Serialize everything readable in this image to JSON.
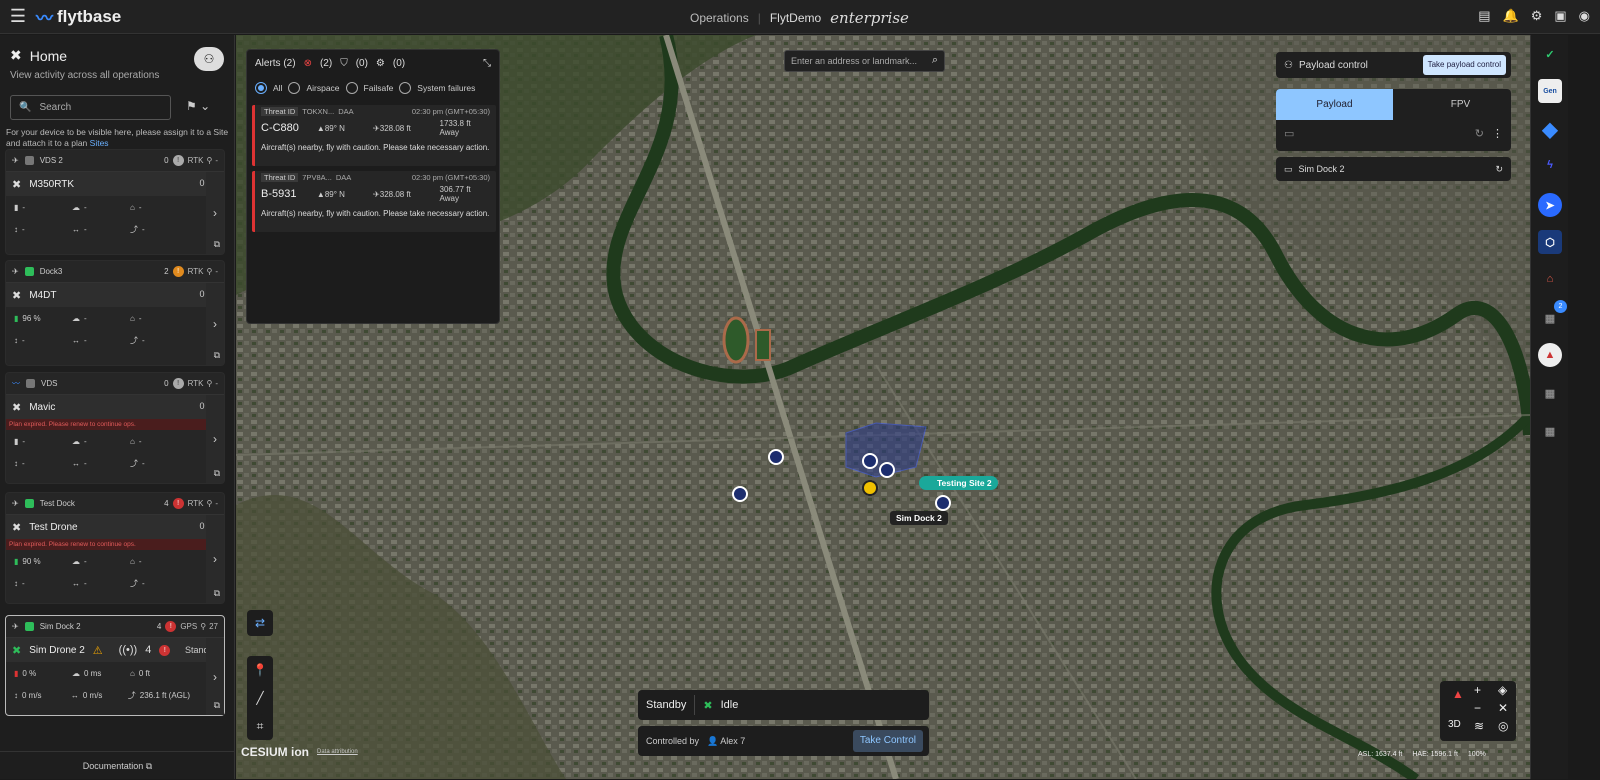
{
  "topbar": {
    "brand": "flytbase",
    "operations": "Operations",
    "org": "FlytDemo",
    "edition": "enterprise"
  },
  "sidebar": {
    "title": "Home",
    "subtitle": "View activity across all operations",
    "search_placeholder": "Search",
    "note": "For your device to be visible here, please assign it to a Site and attach it to a plan",
    "note_link": "Sites",
    "documentation": "Documentation",
    "cards": [
      {
        "dock": "VDS 2",
        "dock_count": "0",
        "rtk": "RTK",
        "drone": "M350RTK",
        "drone_count": "0",
        "battery": "-",
        "wind": "-",
        "home": "-",
        "alt": "-",
        "speed": "-",
        "hspeed": "-",
        "expired": ""
      },
      {
        "dock": "Dock3",
        "dock_count": "2",
        "rtk": "RTK",
        "drone": "M4DT",
        "drone_count": "0",
        "battery": "96 %",
        "wind": "-",
        "home": "-",
        "alt": "-",
        "speed": "-",
        "hspeed": "-",
        "expired": ""
      },
      {
        "dock": "VDS",
        "dock_count": "0",
        "rtk": "RTK",
        "drone": "Mavic",
        "drone_count": "0",
        "battery": "-",
        "wind": "-",
        "home": "-",
        "alt": "-",
        "speed": "-",
        "hspeed": "-",
        "expired": "Plan expired. Please renew to continue ops."
      },
      {
        "dock": "Test Dock",
        "dock_count": "4",
        "rtk": "RTK",
        "drone": "Test Drone",
        "drone_count": "0",
        "battery": "90 %",
        "wind": "-",
        "home": "-",
        "alt": "-",
        "speed": "-",
        "hspeed": "-",
        "expired": "Plan expired. Please renew to continue ops."
      },
      {
        "dock": "Sim Dock 2",
        "dock_count": "4",
        "rtk": "GPS",
        "sats": "27",
        "drone": "Sim Drone 2",
        "drone_count": "4",
        "state": "Standby",
        "battery": "0 %",
        "wind": "0 ms",
        "home": "0 ft",
        "alt": "236.1 ft (AGL)",
        "speed": "0 m/s",
        "hspeed": "0 m/s",
        "expired": ""
      }
    ]
  },
  "alerts": {
    "title": "Alerts (2)",
    "c1": "(2)",
    "c2": "(0)",
    "c3": "(0)",
    "filters": [
      "All",
      "Airspace",
      "Failsafe",
      "System failures"
    ],
    "items": [
      {
        "tid_label": "Threat ID",
        "tid": "TOKXN...",
        "type": "DAA",
        "time": "02:30 pm (GMT+05:30)",
        "callsign": "C-C880",
        "heading": "89° N",
        "alt": "328.08 ft",
        "dist": "1733.8 ft Away",
        "msg": "Aircraft(s) nearby, fly with caution. Please take necessary action."
      },
      {
        "tid_label": "Threat ID",
        "tid": "7PV8A...",
        "type": "DAA",
        "time": "02:30 pm (GMT+05:30)",
        "callsign": "B-5931",
        "heading": "89° N",
        "alt": "328.08 ft",
        "dist": "306.77 ft Away",
        "msg": "Aircraft(s) nearby, fly with caution. Please take necessary action."
      }
    ]
  },
  "map": {
    "address_placeholder": "Enter an address or landmark...",
    "site_label": "Testing Site 2",
    "dock_label": "Sim Dock 2",
    "attribution": "Data attribution",
    "cesium": "CESIUM ion"
  },
  "payload": {
    "title": "Payload control",
    "take": "Take payload control",
    "tab1": "Payload",
    "tab2": "FPV",
    "sim_dock": "Sim Dock 2"
  },
  "status": {
    "mode": "Standby",
    "state": "Idle",
    "controlled_by": "Controlled by",
    "user": "Alex 7",
    "take_control": "Take Control"
  },
  "mapctl": {
    "mode": "3D"
  },
  "footer": {
    "asl": "ASL: 1637.4 ft",
    "hae": "HAE: 1596.1 ft",
    "zoom": "100%"
  },
  "rail": {
    "badge": "2"
  }
}
